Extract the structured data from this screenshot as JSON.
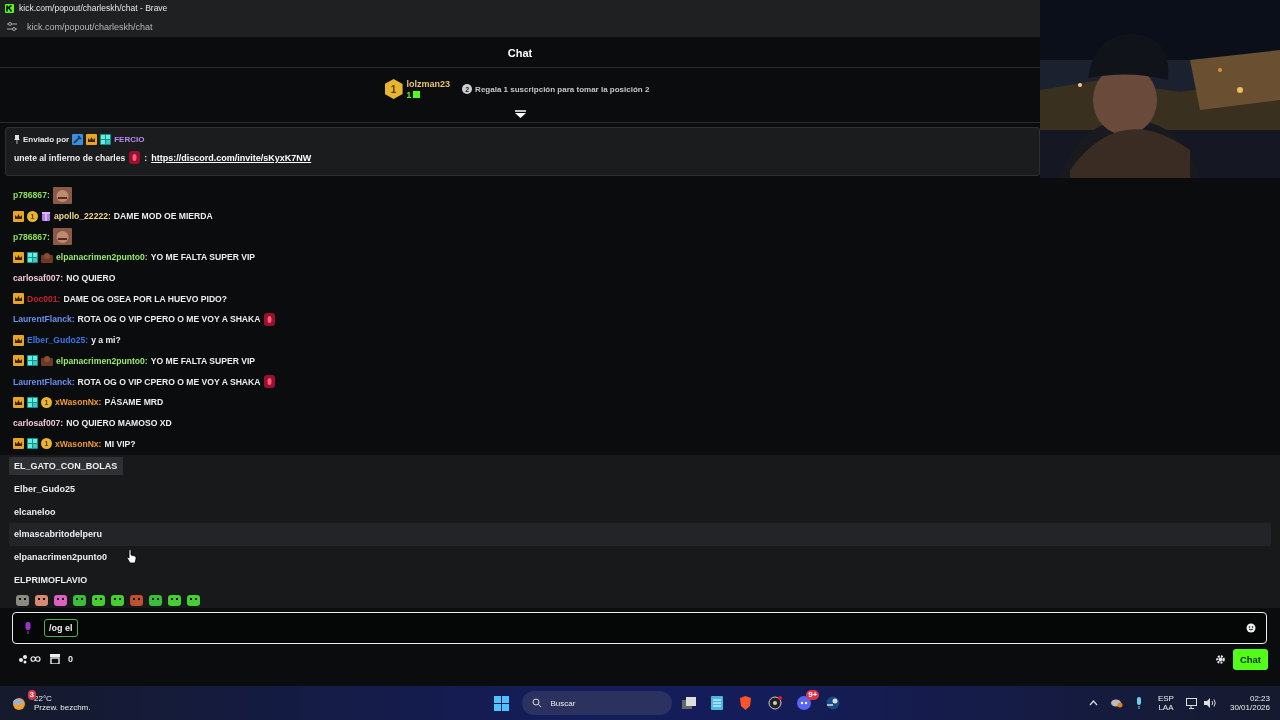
{
  "browser": {
    "title": "kick.com/popout/charleskh/chat - Brave",
    "address": "kick.com/popout/charleskh/chat"
  },
  "chat": {
    "title": "Chat"
  },
  "leaderboard": {
    "rank": "1",
    "user": "lolzman23",
    "gifts": "1",
    "hint_rank": "2",
    "hint": "Regala 1 suscripción para tomar la posición 2"
  },
  "pinned": {
    "label": "Enviado por",
    "badges": [
      {
        "kind": "sword"
      },
      {
        "kind": "crown"
      },
      {
        "kind": "og"
      }
    ],
    "user": "FERCIO",
    "segments": [
      {
        "kind": "text",
        "text": "unete al infierno de charles"
      },
      {
        "kind": "drop"
      },
      {
        "kind": "text",
        "text": ":"
      },
      {
        "kind": "link",
        "text": "https://discord.com/invite/sKyxK7NW"
      }
    ]
  },
  "messages": [
    {
      "user": "p786867:",
      "color": "#8ee05a",
      "segments": [
        {
          "kind": "emote"
        }
      ]
    },
    {
      "user": "apollo_22222:",
      "color": "#eed98a",
      "badges": [
        {
          "kind": "crown"
        },
        {
          "kind": "coin",
          "text": "1"
        },
        {
          "kind": "gift"
        }
      ],
      "segments": [
        {
          "kind": "text",
          "text": "DAME MOD OE MIERDA"
        }
      ]
    },
    {
      "user": "p786867:",
      "color": "#8ee05a",
      "segments": [
        {
          "kind": "emote"
        }
      ]
    },
    {
      "user": "elpanacrimen2punto0:",
      "color": "#9be870",
      "badges": [
        {
          "kind": "crown"
        },
        {
          "kind": "og"
        },
        {
          "kind": "sub"
        }
      ],
      "segments": [
        {
          "kind": "text",
          "text": "YO ME FALTA SUPER VIP"
        }
      ]
    },
    {
      "user": "carlosaf007:",
      "color": "#f2c8dc",
      "segments": [
        {
          "kind": "text",
          "text": "NO QUIERO"
        }
      ]
    },
    {
      "user": "Doc001:",
      "color": "#c8202e",
      "badges": [
        {
          "kind": "crown"
        }
      ],
      "segments": [
        {
          "kind": "text",
          "text": "DAME OG OSEA POR LA HUEVO PIDO?"
        }
      ]
    },
    {
      "user": "LaurentFlanck:",
      "color": "#6a8ff0",
      "segments": [
        {
          "kind": "text",
          "text": "ROTA OG O VIP CPERO O ME VOY A SHAKA"
        },
        {
          "kind": "drop"
        }
      ]
    },
    {
      "user": "Elber_Gudo25:",
      "color": "#3a78e8",
      "badges": [
        {
          "kind": "crown"
        }
      ],
      "segments": [
        {
          "kind": "text",
          "text": "y a mi?"
        }
      ]
    },
    {
      "user": "elpanacrimen2punto0:",
      "color": "#9be870",
      "badges": [
        {
          "kind": "crown"
        },
        {
          "kind": "og"
        },
        {
          "kind": "sub"
        }
      ],
      "segments": [
        {
          "kind": "text",
          "text": "YO ME FALTA SUPER VIP"
        }
      ]
    },
    {
      "user": "LaurentFlanck:",
      "color": "#6a8ff0",
      "segments": [
        {
          "kind": "text",
          "text": "ROTA OG O VIP CPERO O ME VOY A SHAKA"
        },
        {
          "kind": "drop"
        }
      ]
    },
    {
      "user": "xWasonNx:",
      "color": "#f09a30",
      "badges": [
        {
          "kind": "crown"
        },
        {
          "kind": "og"
        },
        {
          "kind": "coin",
          "text": "1"
        }
      ],
      "segments": [
        {
          "kind": "text",
          "text": "PÁSAME MRD"
        }
      ]
    },
    {
      "user": "carlosaf007:",
      "color": "#f2c8dc",
      "segments": [
        {
          "kind": "text",
          "text": "NO QUIERO MAMOSO XD"
        }
      ]
    },
    {
      "user": "xWasonNx:",
      "color": "#f09a30",
      "badges": [
        {
          "kind": "crown"
        },
        {
          "kind": "og"
        },
        {
          "kind": "coin",
          "text": "1"
        }
      ],
      "segments": [
        {
          "kind": "text",
          "text": "MI VIP?"
        }
      ]
    }
  ],
  "suggestions": [
    {
      "label": "EL_GATO_CON_BOLAS",
      "selected": true,
      "hovered": false
    },
    {
      "label": "Elber_Gudo25",
      "selected": false,
      "hovered": false
    },
    {
      "label": "elcaneloo",
      "selected": false,
      "hovered": false
    },
    {
      "label": "elmascabritodelperu",
      "selected": false,
      "hovered": true
    },
    {
      "label": "elpanacrimen2punto0",
      "selected": false,
      "hovered": false
    },
    {
      "label": "ELPRIMOFLAVIO",
      "selected": false,
      "hovered": false
    }
  ],
  "input": {
    "value": "/og el"
  },
  "footer": {
    "count": "0",
    "send": "Chat"
  },
  "taskbar": {
    "temp": "22°C",
    "weather": "Przew. bezchm.",
    "weather_badge": "3",
    "search": "Buscar",
    "discord_badge": "9+",
    "lang": "ESP",
    "layout": "LAA",
    "time": "02:23",
    "date": "30/01/2026"
  }
}
